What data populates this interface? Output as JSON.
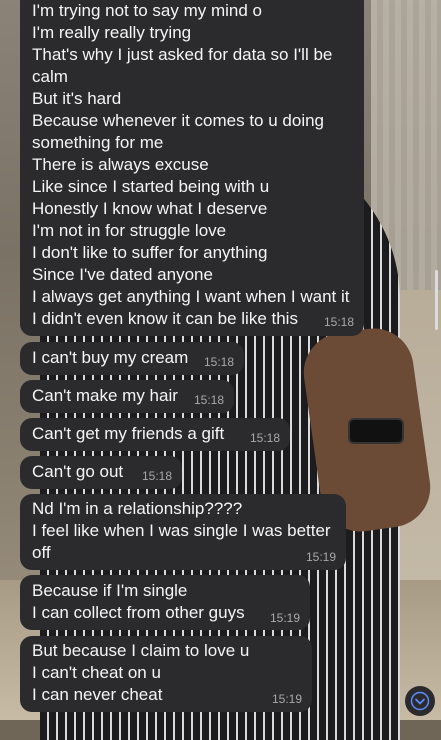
{
  "messages": [
    {
      "lines": [
        "I'm trying not to say my mind o",
        "I'm really really trying",
        "That's why I just asked for data so I'll be",
        "calm",
        "But it's hard",
        "Because whenever it comes to u doing",
        "something for me",
        "There is always excuse",
        "Like since I started being with u",
        "Honestly I know what I deserve",
        "I'm not in for struggle love",
        "I don't like to suffer for anything",
        "Since I've dated anyone",
        "I always get anything I want when I want it",
        "I didn't even know it can be like this"
      ],
      "time": "15:18"
    },
    {
      "lines": [
        "I can't buy my cream"
      ],
      "time": "15:18"
    },
    {
      "lines": [
        "Can't make my hair"
      ],
      "time": "15:18"
    },
    {
      "lines": [
        "Can't get my friends a gift"
      ],
      "time": "15:18"
    },
    {
      "lines": [
        "Can't go out"
      ],
      "time": "15:18"
    },
    {
      "lines": [
        "Nd I'm in a relationship????",
        "I feel like when I was single I was better",
        "off"
      ],
      "time": "15:19"
    },
    {
      "lines": [
        "Because if I'm single",
        "I can collect from other guys"
      ],
      "time": "15:19"
    },
    {
      "lines": [
        "But because I claim to love u",
        "I can't cheat on u",
        "I can never cheat"
      ],
      "time": "15:19"
    }
  ],
  "icons": {
    "scroll_down": "chevron-down-icon"
  },
  "colors": {
    "bubble": "#2b2b2d",
    "text": "#f5f5f5",
    "timestamp": "#a8a8a8",
    "scroll_chevron": "#5a8cff"
  }
}
